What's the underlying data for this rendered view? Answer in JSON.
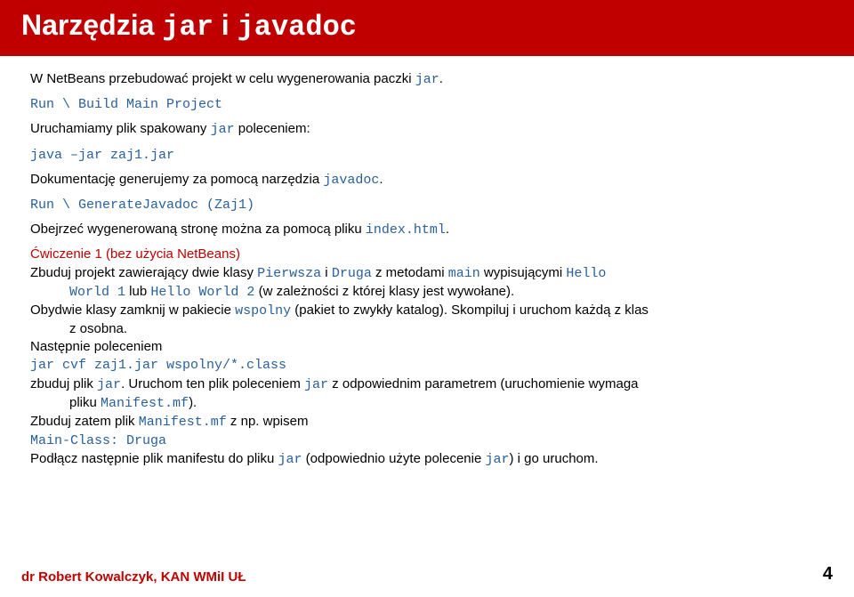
{
  "header": {
    "title_part1": "Narzędzia ",
    "title_code1": "jar",
    "title_part2": " i ",
    "title_code2": "javadoc"
  },
  "p1": {
    "t1": "W NetBeans przebudować projekt w celu wygenerowania paczki ",
    "c1": "jar",
    "t2": "."
  },
  "p2": {
    "c1": "Run \\ Build Main Project"
  },
  "p3": {
    "t1": "Uruchamiamy plik spakowany ",
    "c1": "jar",
    "t2": " poleceniem:"
  },
  "p4": {
    "c1": "java –jar zaj1.jar"
  },
  "p5": {
    "t1": "Dokumentację generujemy za pomocą narzędzia ",
    "c1": "javadoc",
    "t2": "."
  },
  "p6": {
    "c1": "Run \\ GenerateJavadoc (Zaj1)"
  },
  "p7": {
    "t1": "Obejrzeć wygenerowaną stronę można za pomocą pliku ",
    "c1": "index.html",
    "t2": "."
  },
  "ex": {
    "title": "Ćwiczenie 1 (bez użycia NetBeans)",
    "l1a": "Zbuduj projekt zawierający dwie klasy ",
    "l1b": "Pierwsza",
    "l1c": " i ",
    "l1d": "Druga",
    "l1e": " z metodami ",
    "l1f": "main",
    "l1g": " wypisującymi ",
    "l1h": "Hello",
    "l2a": "World 1",
    "l2b": " lub ",
    "l2c": "Hello World 2",
    "l2d": " (w zależności z której klasy jest wywołane).",
    "l3a": "Obydwie klasy zamknij w pakiecie ",
    "l3b": "wspolny",
    "l3c": " (pakiet to zwykły katalog). Skompiluj i uruchom każdą z klas",
    "l4": "z osobna.",
    "l5": "Następnie poleceniem",
    "l6": "jar cvf zaj1.jar wspolny/*.class",
    "l7a": "zbuduj plik ",
    "l7b": "jar",
    "l7c": ". Uruchom ten plik poleceniem ",
    "l7d": "jar",
    "l7e": " z odpowiednim parametrem (uruchomienie wymaga",
    "l8a": "pliku ",
    "l8b": "Manifest.mf",
    "l8c": ").",
    "l9a": "Zbuduj zatem plik ",
    "l9b": "Manifest.mf",
    "l9c": " z np. wpisem",
    "l10": "Main-Class: Druga",
    "l11a": "Podłącz następnie plik manifestu do pliku ",
    "l11b": "jar",
    "l11c": " (odpowiednio użyte polecenie ",
    "l11d": "jar",
    "l11e": ") i go uruchom."
  },
  "footer": {
    "author": "dr Robert Kowalczyk, KAN WMiI UŁ",
    "page": "4"
  }
}
